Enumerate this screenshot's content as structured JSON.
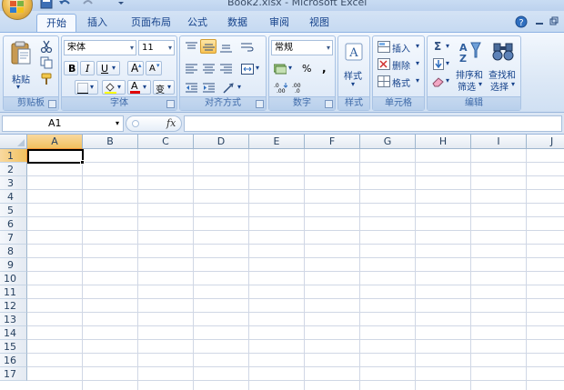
{
  "window": {
    "title": "Book2.xlsx - Microsoft Excel"
  },
  "tabs": [
    {
      "label": "开始",
      "active": true
    },
    {
      "label": "插入"
    },
    {
      "label": "页面布局"
    },
    {
      "label": "公式"
    },
    {
      "label": "数据"
    },
    {
      "label": "审阅"
    },
    {
      "label": "视图"
    }
  ],
  "ribbon": {
    "clipboard": {
      "label": "剪贴板",
      "paste_label": "粘贴"
    },
    "font": {
      "label": "字体",
      "font_name": "宋体",
      "font_size": "11",
      "bold": "B",
      "italic": "I",
      "underline": "U",
      "grow": "A",
      "shrink": "A",
      "font_color_letter": "A",
      "phonetic": "变"
    },
    "alignment": {
      "label": "对齐方式"
    },
    "number": {
      "label": "数字",
      "format": "常规",
      "percent": "%",
      "comma": ","
    },
    "styles": {
      "label": "样式",
      "button_label": "样式"
    },
    "cells": {
      "label": "单元格",
      "insert": "插入",
      "delete": "删除",
      "format": "格式"
    },
    "editing": {
      "label": "编辑",
      "sum": "Σ",
      "sort_label": "排序和",
      "sort_label2": "筛选",
      "find_label": "查找和",
      "find_label2": "选择"
    }
  },
  "formula_bar": {
    "name_box": "A1",
    "fx": "fx",
    "formula": ""
  },
  "grid": {
    "columns": [
      "A",
      "B",
      "C",
      "D",
      "E",
      "F",
      "G",
      "H",
      "I",
      "J"
    ],
    "rows": [
      "1",
      "2",
      "3",
      "4",
      "5",
      "6",
      "7",
      "8",
      "9",
      "10",
      "11",
      "12",
      "13",
      "14",
      "15",
      "16",
      "17"
    ],
    "selected_cell": "A1"
  },
  "colors": {
    "accent": "#15428b",
    "selected_header": "#f1c15f",
    "gridline": "#d0d7e5"
  }
}
